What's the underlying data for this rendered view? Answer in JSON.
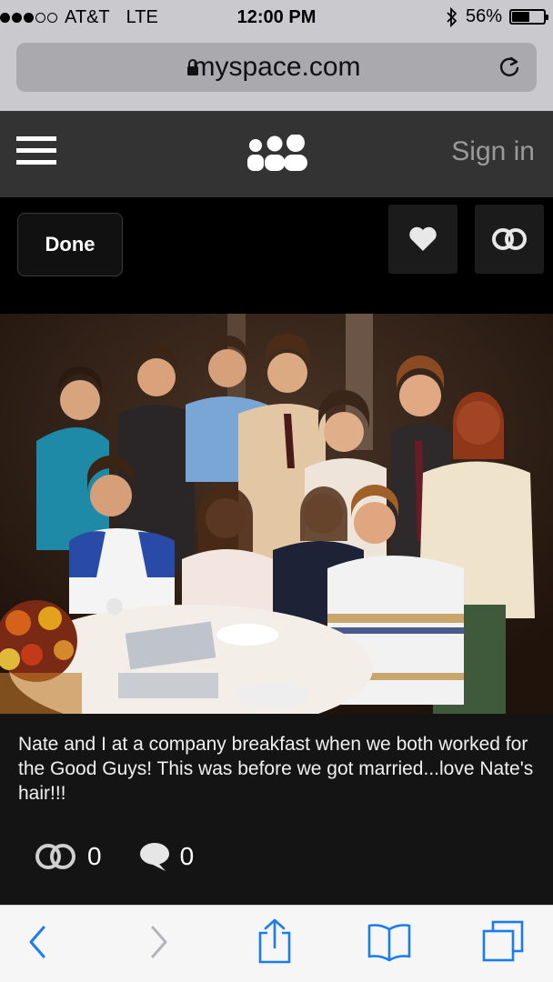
{
  "status_bar": {
    "signal_filled": 3,
    "signal_total": 5,
    "carrier": "AT&T",
    "network": "LTE",
    "time": "12:00 PM",
    "battery_percent": "56%",
    "battery_level": 0.56,
    "icons": [
      "bluetooth-icon",
      "battery-icon"
    ]
  },
  "browser": {
    "url": "myspace.com",
    "icons": [
      "lock-icon",
      "reload-icon"
    ]
  },
  "nav": {
    "sign_in": "Sign in",
    "icons": [
      "menu-icon",
      "myspace-logo-icon"
    ]
  },
  "actions": {
    "done_label": "Done",
    "icons": [
      "heart-icon",
      "connect-icon"
    ]
  },
  "post": {
    "caption": "Nate and I at a company breakfast when we both worked for the Good Guys! This was before we got married...love Nate's hair!!!",
    "connects": "0",
    "comments": "0"
  },
  "toolbar": {
    "icons": [
      "back-icon",
      "forward-icon",
      "share-icon",
      "bookmarks-icon",
      "tabs-icon"
    ]
  },
  "colors": {
    "nav_bg": "#333333",
    "safari_blue": "#1a7cf5",
    "caption_bg": "#141414"
  }
}
